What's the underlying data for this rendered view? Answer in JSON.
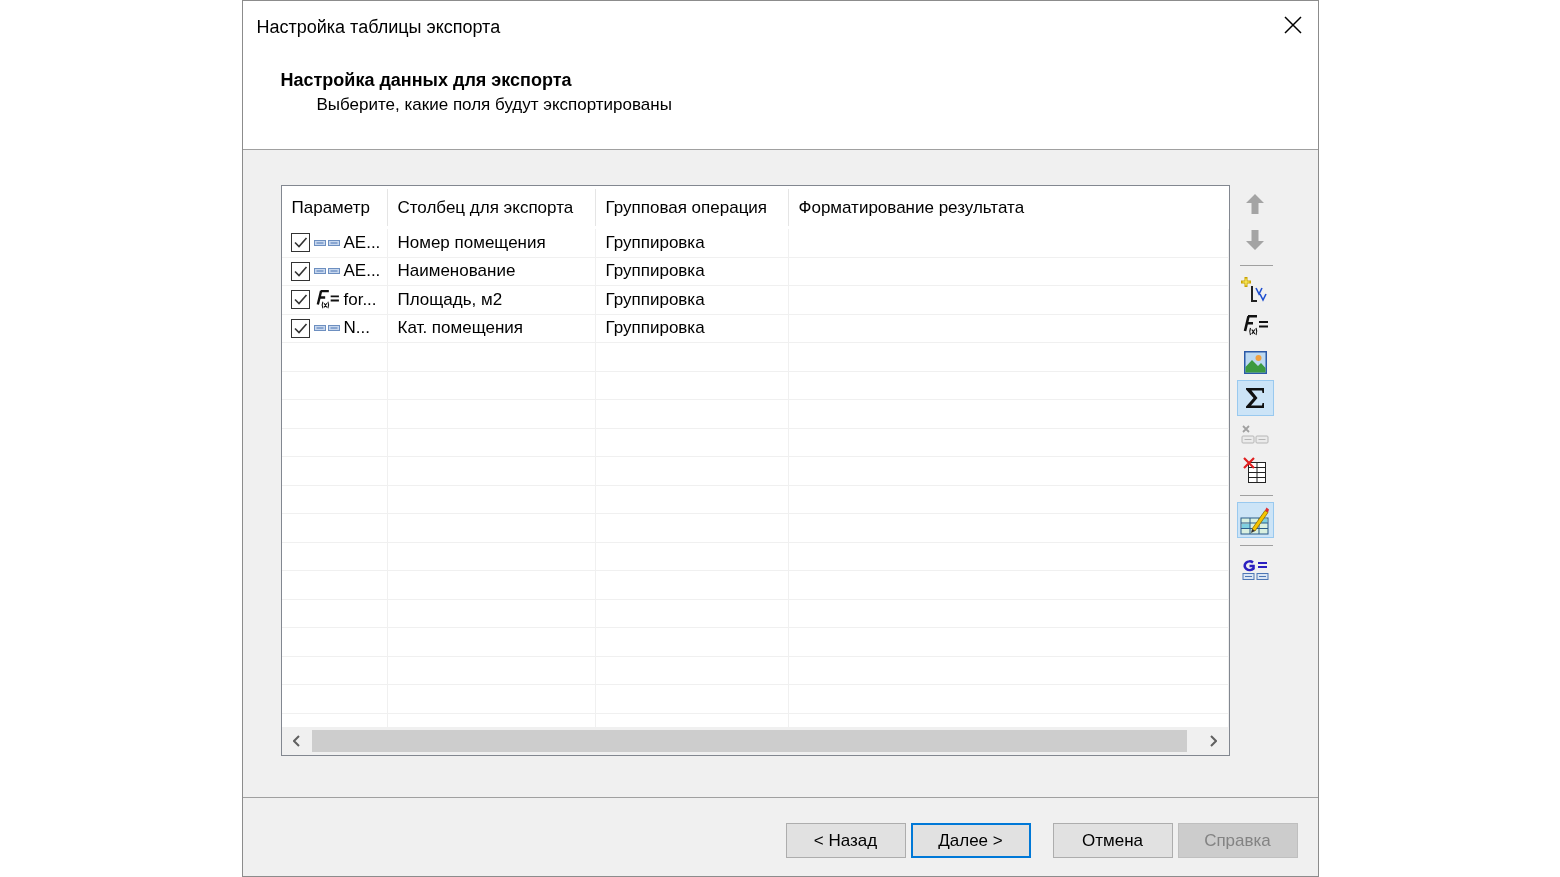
{
  "window": {
    "title": "Настройка таблицы экспорта"
  },
  "page": {
    "heading": "Настройка данных для экспорта",
    "subheading": "Выберите, какие поля будут экспортированы"
  },
  "table": {
    "columns": [
      "Параметр",
      "Столбец для экспорта",
      "Групповая операция",
      "Форматирование результата"
    ],
    "rows": [
      {
        "checked": true,
        "kind": "field",
        "parameter": "AE...",
        "column": "Номер помещения",
        "operation": "Группировка"
      },
      {
        "checked": true,
        "kind": "field",
        "parameter": "AE...",
        "column": "Наименование",
        "operation": "Группировка"
      },
      {
        "checked": true,
        "kind": "formula",
        "parameter": "for...",
        "column": "Площадь, м2",
        "operation": "Группировка"
      },
      {
        "checked": true,
        "kind": "field",
        "parameter": "N...",
        "column": "Кат. помещения",
        "operation": "Группировка"
      }
    ]
  },
  "toolbar": {
    "groups": [
      [
        {
          "disabled": true,
          "selected": false
        },
        {
          "disabled": true,
          "selected": false
        }
      ],
      [
        {
          "disabled": false,
          "selected": false
        },
        {
          "disabled": false,
          "selected": false
        },
        {
          "disabled": false,
          "selected": false
        },
        {
          "disabled": false,
          "selected": true
        },
        {
          "disabled": true,
          "selected": false
        },
        {
          "disabled": false,
          "selected": false
        }
      ],
      [
        {
          "disabled": false,
          "selected": true
        }
      ],
      [
        {
          "disabled": false,
          "selected": false
        }
      ]
    ]
  },
  "footer": {
    "wizard_buttons": [
      {
        "label": "< Назад",
        "default": false,
        "disabled": false
      },
      {
        "label": "Далее >",
        "default": true,
        "disabled": false
      }
    ],
    "buttons": [
      {
        "label": "Отмена",
        "default": false,
        "disabled": false
      },
      {
        "label": "Справка",
        "default": false,
        "disabled": true
      }
    ]
  }
}
